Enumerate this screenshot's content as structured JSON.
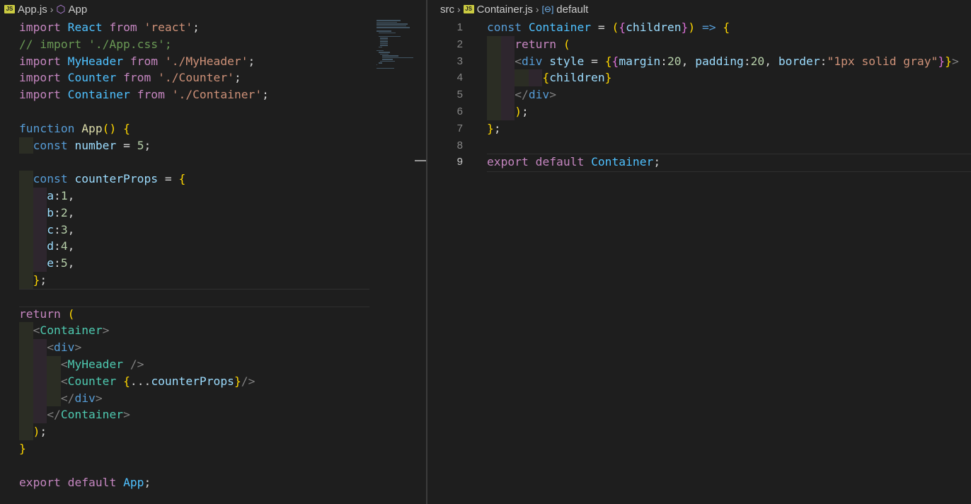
{
  "left_editor": {
    "breadcrumb": {
      "file": "App.js",
      "symbol": "App",
      "file_icon": "js-file-icon",
      "symbol_icon": "cube-icon"
    },
    "code": [
      "import React from 'react';",
      "// import './App.css';",
      "import MyHeader from './MyHeader';",
      "import Counter from './Counter';",
      "import Container from './Container';",
      "",
      "function App() {",
      "  const number = 5;",
      "",
      "  const counterProps = {",
      "    a:1,",
      "    b:2,",
      "    c:3,",
      "    d:4,",
      "    e:5,",
      "  };",
      "",
      "return (",
      "  <Container>",
      "    <div>",
      "      <MyHeader />",
      "      <Counter {...counterProps}/>",
      "      </div>",
      "    </Container>",
      "  );",
      "}",
      "",
      "export default App;"
    ]
  },
  "right_editor": {
    "breadcrumb": {
      "folder": "src",
      "file": "Container.js",
      "symbol": "default",
      "file_icon": "js-file-icon",
      "symbol_icon": "variable-icon"
    },
    "line_numbers": [
      "1",
      "2",
      "3",
      "4",
      "5",
      "6",
      "7",
      "8",
      "9"
    ],
    "active_line": "9",
    "code": [
      "const Container = ({children}) => {",
      "    return (",
      "    <div style = {{margin:20, padding:20, border:\"1px solid gray\"}}>",
      "        {children}",
      "    </div>",
      "    );",
      "};",
      "",
      "export default Container;"
    ]
  },
  "colors": {
    "background": "#1e1e1e",
    "keyword": "#569cd6",
    "control": "#c586c0",
    "string": "#ce9178",
    "comment": "#6a9955",
    "function": "#dcdcaa",
    "variable": "#9cdcfe",
    "component": "#4ec9b0"
  }
}
